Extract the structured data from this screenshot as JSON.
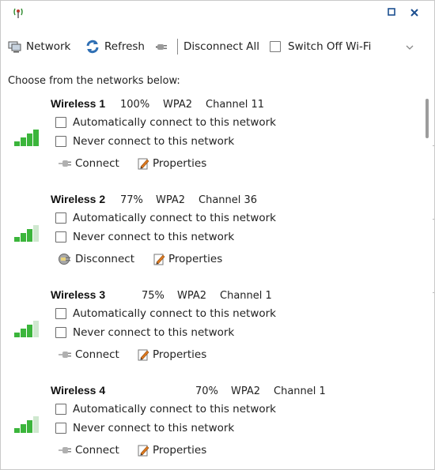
{
  "toolbar": {
    "network_label": "Network",
    "refresh_label": "Refresh",
    "disconnect_all_label": "Disconnect All",
    "switch_off_label": "Switch Off Wi-Fi"
  },
  "prompt": "Choose from the networks below:",
  "networks": [
    {
      "name": "Wireless 1",
      "strength": "100%",
      "security": "WPA2",
      "channel": "Channel 11",
      "auto_label": "Automatically connect to this network",
      "never_label": "Never connect to this network",
      "connect_label": "Connect",
      "properties_label": "Properties",
      "signal_level": 1.0,
      "connected": false
    },
    {
      "name": "Wireless 2",
      "strength": "77%",
      "security": "WPA2",
      "channel": "Channel 36",
      "auto_label": "Automatically connect to this network",
      "never_label": "Never connect to this network",
      "connect_label": "Disconnect",
      "properties_label": "Properties",
      "signal_level": 0.77,
      "connected": true
    },
    {
      "name": "Wireless 3",
      "strength": "75%",
      "security": "WPA2",
      "channel": "Channel 1",
      "auto_label": "Automatically connect to this network",
      "never_label": "Never connect to this network",
      "connect_label": "Connect",
      "properties_label": "Properties",
      "signal_level": 0.75,
      "connected": false
    },
    {
      "name": "Wireless 4",
      "strength": "70%",
      "security": "WPA2",
      "channel": "Channel 1",
      "auto_label": "Automatically connect to this network",
      "never_label": "Never connect to this network",
      "connect_label": "Connect",
      "properties_label": "Properties",
      "signal_level": 0.7,
      "connected": false
    }
  ],
  "colors": {
    "signal_on": "#3bb53b",
    "signal_off": "#cfe8cf",
    "title_button": "#1c4f8f"
  }
}
